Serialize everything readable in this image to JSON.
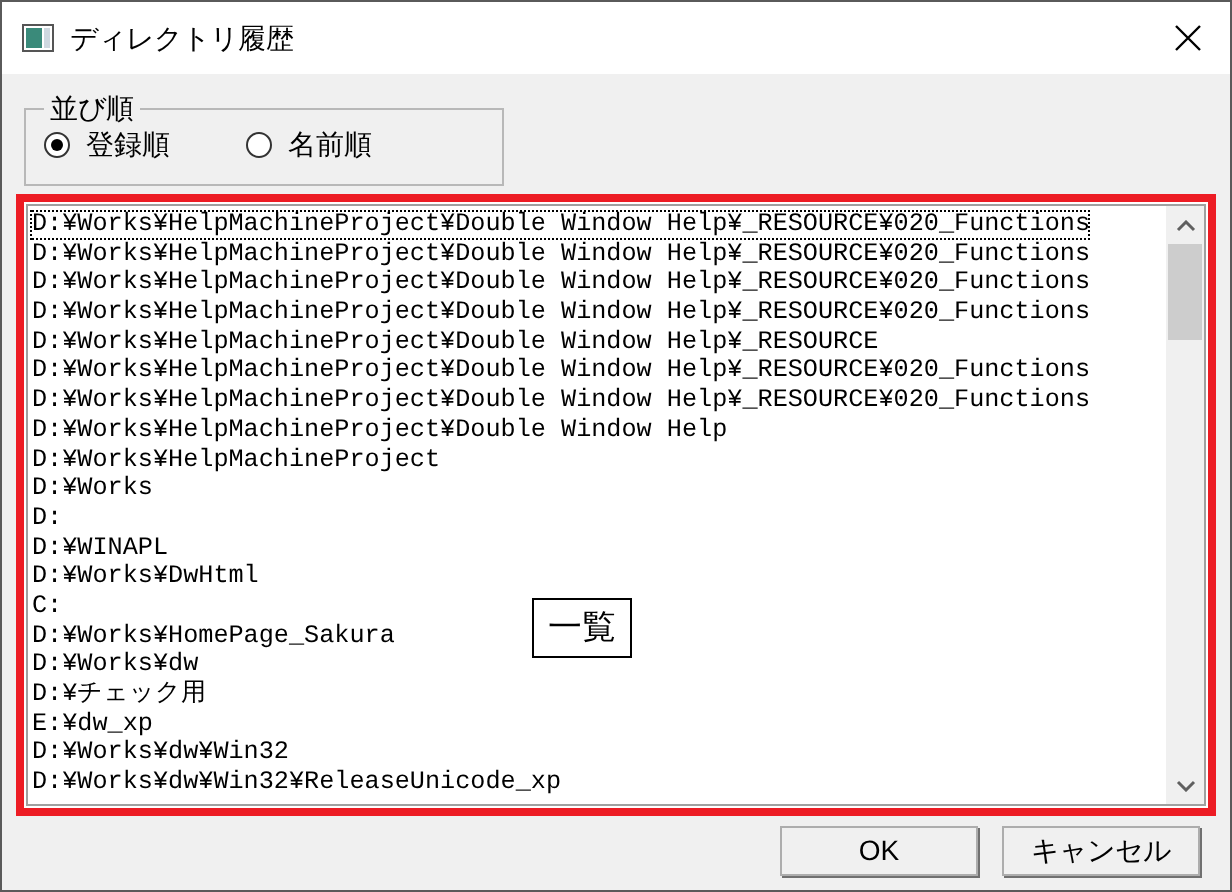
{
  "window": {
    "title": "ディレクトリ履歴"
  },
  "sort_group": {
    "label": "並び順",
    "options": [
      {
        "label": "登録順",
        "selected": true
      },
      {
        "label": "名前順",
        "selected": false
      }
    ]
  },
  "list": {
    "items": [
      {
        "text": "D:¥Works¥HelpMachineProject¥Double Window Help¥_RESOURCE¥020_Functions",
        "selected": true
      },
      {
        "text": "D:¥Works¥HelpMachineProject¥Double Window Help¥_RESOURCE¥020_Functions",
        "selected": false
      },
      {
        "text": "D:¥Works¥HelpMachineProject¥Double Window Help¥_RESOURCE¥020_Functions",
        "selected": false
      },
      {
        "text": "D:¥Works¥HelpMachineProject¥Double Window Help¥_RESOURCE¥020_Functions",
        "selected": false
      },
      {
        "text": "D:¥Works¥HelpMachineProject¥Double Window Help¥_RESOURCE",
        "selected": false
      },
      {
        "text": "D:¥Works¥HelpMachineProject¥Double Window Help¥_RESOURCE¥020_Functions",
        "selected": false
      },
      {
        "text": "D:¥Works¥HelpMachineProject¥Double Window Help¥_RESOURCE¥020_Functions",
        "selected": false
      },
      {
        "text": "D:¥Works¥HelpMachineProject¥Double Window Help",
        "selected": false
      },
      {
        "text": "D:¥Works¥HelpMachineProject",
        "selected": false
      },
      {
        "text": "D:¥Works",
        "selected": false
      },
      {
        "text": "D:",
        "selected": false
      },
      {
        "text": "D:¥WINAPL",
        "selected": false
      },
      {
        "text": "D:¥Works¥DwHtml",
        "selected": false
      },
      {
        "text": "C:",
        "selected": false
      },
      {
        "text": "D:¥Works¥HomePage_Sakura",
        "selected": false
      },
      {
        "text": "D:¥Works¥dw",
        "selected": false
      },
      {
        "text": "D:¥チェック用",
        "selected": false
      },
      {
        "text": "E:¥dw_xp",
        "selected": false
      },
      {
        "text": "D:¥Works¥dw¥Win32",
        "selected": false
      },
      {
        "text": "D:¥Works¥dw¥Win32¥ReleaseUnicode_xp",
        "selected": false
      }
    ]
  },
  "callout": {
    "label": "一覧"
  },
  "buttons": [
    "OK",
    "キャンセル"
  ]
}
